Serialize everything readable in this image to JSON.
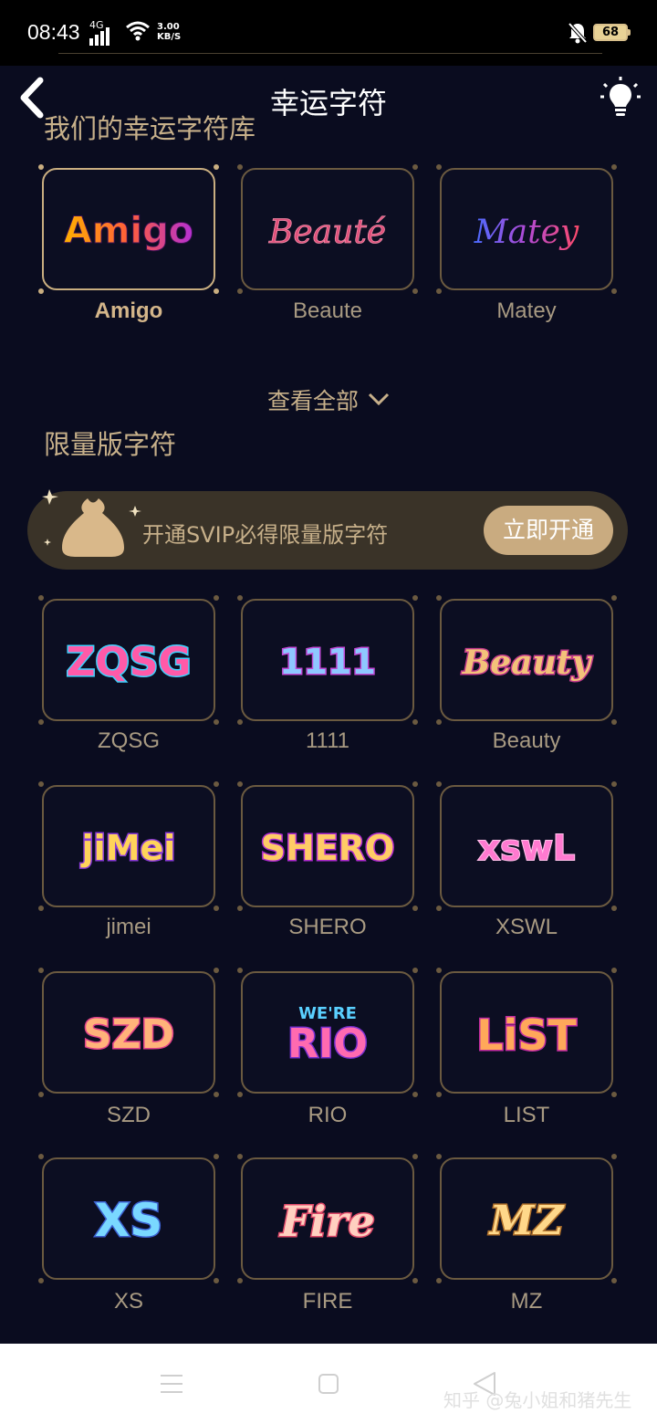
{
  "status_bar": {
    "time": "08:43",
    "network": "4G",
    "speed": "3.00 KB/S",
    "battery": "68"
  },
  "header": {
    "title": "幸运字符"
  },
  "library": {
    "title": "我们的幸运字符库",
    "view_all": "查看全部",
    "items": [
      {
        "label": "Amigo",
        "selected": true
      },
      {
        "label": "Beaute"
      },
      {
        "label": "Matey"
      }
    ]
  },
  "limited": {
    "title": "限量版字符",
    "banner_text": "开通SVIP必得限量版字符",
    "banner_button": "立即开通",
    "items": [
      {
        "label": "ZQSG"
      },
      {
        "label": "1111"
      },
      {
        "label": "Beauty"
      },
      {
        "label": "jimei"
      },
      {
        "label": "SHERO"
      },
      {
        "label": "XSWL"
      },
      {
        "label": "SZD"
      },
      {
        "label": "RIO"
      },
      {
        "label": "LIST"
      },
      {
        "label": "XS"
      },
      {
        "label": "FIRE"
      },
      {
        "label": "MZ"
      }
    ]
  },
  "logo_art": {
    "amigo": "Amigo",
    "beaute": "Beauté",
    "matey": "Matey",
    "zqsg": "ZQSG",
    "n1111": "1111",
    "beauty": "Beauty",
    "jimei": "jiMei",
    "shero": "SHERO",
    "xswl": "xswL",
    "szd": "SZD",
    "rio": "RIO",
    "rio_top": "WE'RE",
    "list": "LiST",
    "xs": "XS",
    "fire": "Fire",
    "mz": "MZ"
  },
  "watermark": "知乎 @兔小姐和猪先生",
  "colors": {
    "background": "#0a0c1f",
    "gold": "#c7b08a",
    "button": "#c9ab80"
  }
}
